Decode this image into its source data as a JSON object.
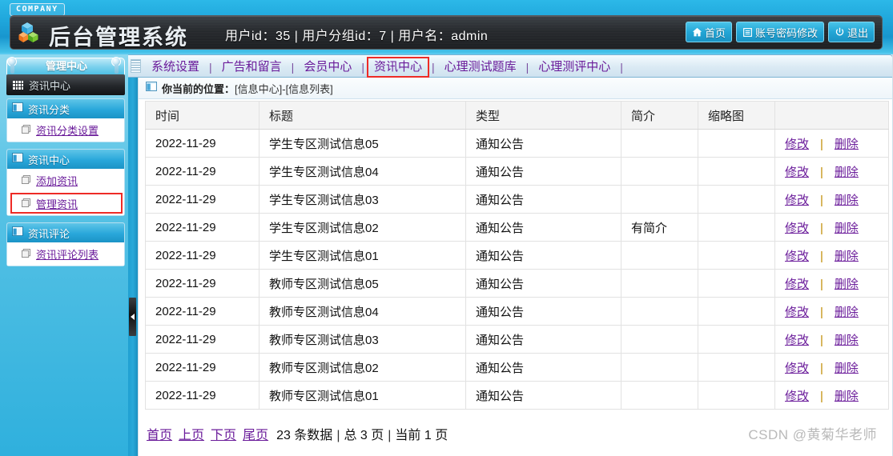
{
  "header": {
    "company_badge": "COMPANY",
    "system_title": "后台管理系统",
    "user_info": "用户id：35 | 用户分组id：7 | 用户名：admin",
    "buttons": [
      {
        "label": "首页",
        "icon": "home-icon"
      },
      {
        "label": "账号密码修改",
        "icon": "document-icon"
      },
      {
        "label": "退出",
        "icon": "power-icon"
      }
    ],
    "menu_icon": "hamburger-icon",
    "logo_icon": "cubes-logo-icon"
  },
  "nav": {
    "items": [
      {
        "label": "系统设置",
        "active": false
      },
      {
        "label": "广告和留言",
        "active": false
      },
      {
        "label": "会员中心",
        "active": false
      },
      {
        "label": "资讯中心",
        "active": true
      },
      {
        "label": "心理测试题库",
        "active": false
      },
      {
        "label": "心理测评中心",
        "active": false
      }
    ],
    "separator": "|"
  },
  "sidebar": {
    "tab_label": "管理中心",
    "section_label": "资讯中心",
    "section_icon": "grid-dots-icon",
    "groups": [
      {
        "title": "资讯分类",
        "icon": "window-icon",
        "items": [
          {
            "label": "资讯分类设置",
            "icon": "page-icon",
            "highlighted": false
          }
        ]
      },
      {
        "title": "资讯中心",
        "icon": "window-icon",
        "items": [
          {
            "label": "添加资讯",
            "icon": "page-icon",
            "highlighted": false
          },
          {
            "label": "管理资讯",
            "icon": "page-icon",
            "highlighted": true
          }
        ]
      },
      {
        "title": "资讯评论",
        "icon": "window-icon",
        "items": [
          {
            "label": "资讯评论列表",
            "icon": "page-icon",
            "highlighted": false
          }
        ]
      }
    ]
  },
  "main": {
    "breadcrumb_prefix": "你当前的位置：",
    "breadcrumb_location": "[信息中心]-[信息列表]",
    "breadcrumb_icon": "window-icon",
    "table": {
      "columns": [
        "时间",
        "标题",
        "类型",
        "简介",
        "缩略图",
        ""
      ],
      "rows": [
        {
          "time": "2022-11-29",
          "title": "学生专区测试信息05",
          "type": "通知公告",
          "desc": "",
          "thumb": ""
        },
        {
          "time": "2022-11-29",
          "title": "学生专区测试信息04",
          "type": "通知公告",
          "desc": "",
          "thumb": ""
        },
        {
          "time": "2022-11-29",
          "title": "学生专区测试信息03",
          "type": "通知公告",
          "desc": "",
          "thumb": ""
        },
        {
          "time": "2022-11-29",
          "title": "学生专区测试信息02",
          "type": "通知公告",
          "desc": "有简介",
          "thumb": ""
        },
        {
          "time": "2022-11-29",
          "title": "学生专区测试信息01",
          "type": "通知公告",
          "desc": "",
          "thumb": ""
        },
        {
          "time": "2022-11-29",
          "title": "教师专区测试信息05",
          "type": "通知公告",
          "desc": "",
          "thumb": ""
        },
        {
          "time": "2022-11-29",
          "title": "教师专区测试信息04",
          "type": "通知公告",
          "desc": "",
          "thumb": ""
        },
        {
          "time": "2022-11-29",
          "title": "教师专区测试信息03",
          "type": "通知公告",
          "desc": "",
          "thumb": ""
        },
        {
          "time": "2022-11-29",
          "title": "教师专区测试信息02",
          "type": "通知公告",
          "desc": "",
          "thumb": ""
        },
        {
          "time": "2022-11-29",
          "title": "教师专区测试信息01",
          "type": "通知公告",
          "desc": "",
          "thumb": ""
        }
      ],
      "edit_label": "修改",
      "delete_label": "删除",
      "action_separator": "|"
    },
    "pager": {
      "first": "首页",
      "prev": "上页",
      "next": "下页",
      "last": "尾页",
      "total_records": "23 条数据",
      "total_pages": "总 3 页",
      "current_page": "当前 1 页",
      "separator": "|"
    },
    "watermark": "CSDN @黄菊华老师"
  },
  "colors": {
    "accent_blue": "#29a7da",
    "link_purple": "#6a1b9a",
    "highlight_red": "#ee2b26",
    "header_dark": "#24272b"
  }
}
